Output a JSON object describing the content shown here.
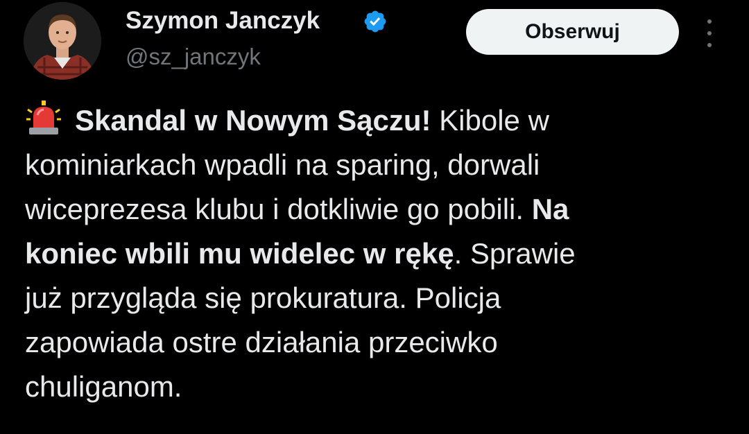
{
  "author": {
    "display_name": "Szymon Janczyk",
    "handle": "@sz_janczyk",
    "avatar_icon": "user-avatar-photo",
    "verified_icon": "verified-badge-icon"
  },
  "actions": {
    "follow_label": "Obserwuj",
    "more_icon": "more-options-icon"
  },
  "tweet": {
    "emoji": "police-siren-emoji",
    "bold1": "Skandal w Nowym Sączu!",
    "l1_rest": "Kibole w",
    "l2": "kominiarkach wpadli na sparing, dorwali",
    "l3_plain": "wiceprezesa klubu i dotkliwie go pobili.",
    "l3_bold": "Na",
    "l4_bold": "koniec wbili mu widelec w rękę",
    "l4_rest": ". Sprawie",
    "l5": "już przygląda się prokuratura. Policja",
    "l6": "zapowiada ostre działania przeciwko",
    "l7": "chuliganom."
  },
  "colors": {
    "background": "#000000",
    "text": "#e7e9ea",
    "secondary_text": "#71767b",
    "verified": "#1d9bf0",
    "follow_bg": "#eff3f4"
  }
}
